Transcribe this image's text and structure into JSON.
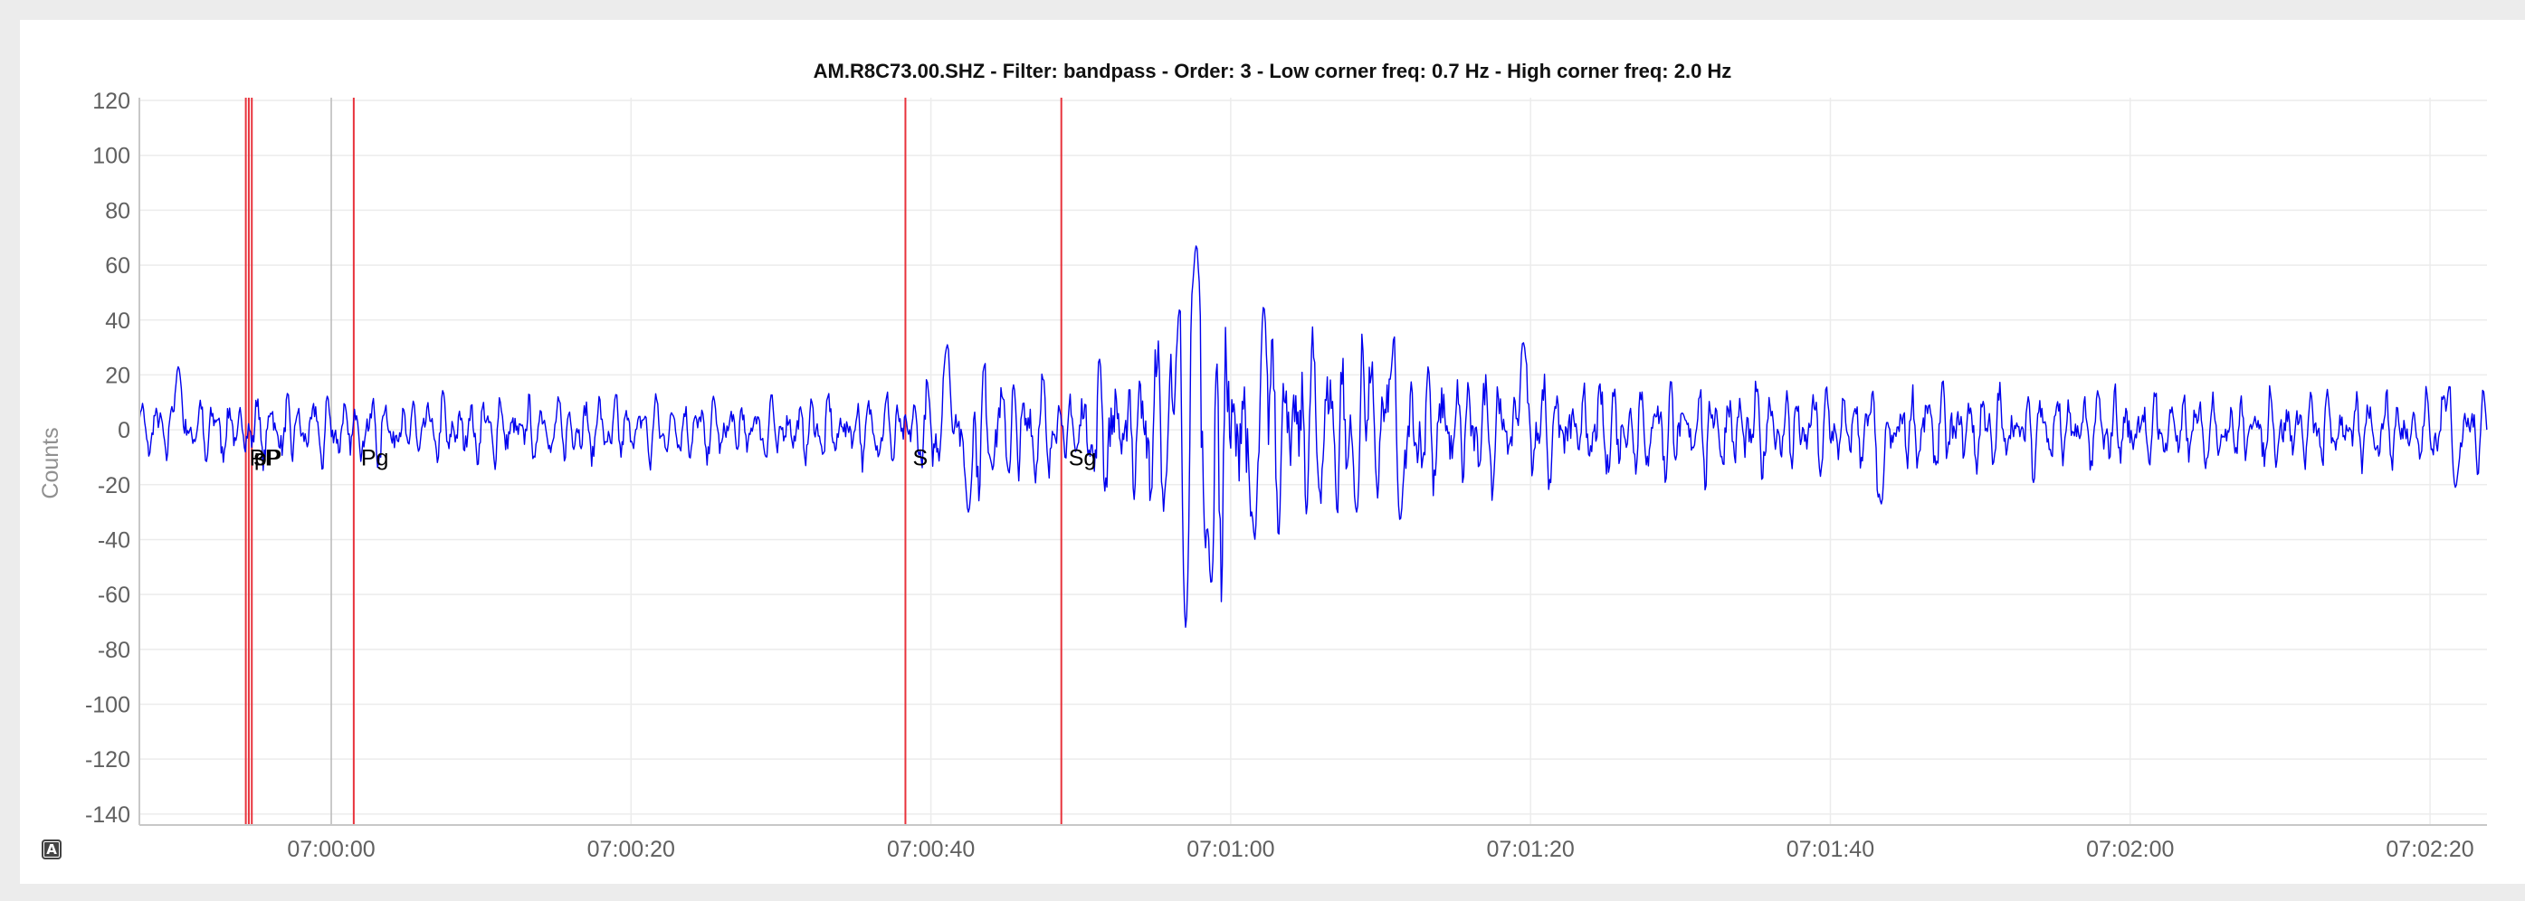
{
  "chart_data": {
    "type": "line",
    "title": "AM.R8C73.00.SHZ - Filter: bandpass - Order: 3 - Low corner freq: 0.7 Hz - High corner freq: 2.0 Hz",
    "ylabel": "Counts",
    "xlabel": "",
    "ylim": [
      -144,
      121
    ],
    "xlim": [
      "06:59:47.2",
      "07:02:23.8"
    ],
    "yticks": [
      120,
      100,
      80,
      60,
      40,
      20,
      0,
      -20,
      -40,
      -60,
      -80,
      -100,
      -120,
      -140
    ],
    "xticks": [
      "07:00:00",
      "07:00:20",
      "07:00:40",
      "07:01:00",
      "07:01:20",
      "07:01:40",
      "07:02:00",
      "07:02:20"
    ],
    "grid": true,
    "series_color": "#0000ee",
    "pick_color": "#e8333c",
    "grey_marker_color": "#bbbbbb",
    "grey_marker_time": "07:00:00",
    "picks": [
      {
        "label": "P",
        "time": "06:59:54.3"
      },
      {
        "label": "pP",
        "time": "06:59:54.5"
      },
      {
        "label": "sP",
        "time": "06:59:54.7"
      },
      {
        "label": "Pg",
        "time": "07:00:01.5"
      },
      {
        "label": "S",
        "time": "07:00:38.3"
      },
      {
        "label": "Sg",
        "time": "07:00:48.7"
      }
    ],
    "envelope": [
      {
        "t": "06:59:47.2",
        "amp": 12
      },
      {
        "t": "06:59:58",
        "amp": 15
      },
      {
        "t": "07:00:30",
        "amp": 13
      },
      {
        "t": "07:00:38",
        "amp": 15
      },
      {
        "t": "07:00:43",
        "amp": 24
      },
      {
        "t": "07:00:50",
        "amp": 22
      },
      {
        "t": "07:00:55",
        "amp": 38
      },
      {
        "t": "07:00:58",
        "amp": 60
      },
      {
        "t": "07:01:01",
        "amp": 52
      },
      {
        "t": "07:01:04",
        "amp": 40
      },
      {
        "t": "07:01:10",
        "amp": 28
      },
      {
        "t": "07:01:20",
        "amp": 22
      },
      {
        "t": "07:01:40",
        "amp": 18
      },
      {
        "t": "07:02:23.8",
        "amp": 15
      }
    ],
    "peaks": [
      {
        "t": "06:59:49.8",
        "y": 23
      },
      {
        "t": "07:00:41.1",
        "y": 31
      },
      {
        "t": "07:00:42.5",
        "y": -30
      },
      {
        "t": "07:00:56.6",
        "y": 44
      },
      {
        "t": "07:00:57.4",
        "y": 43
      },
      {
        "t": "07:00:57.7",
        "y": 67
      },
      {
        "t": "07:00:57.0",
        "y": -72
      },
      {
        "t": "07:00:58.7",
        "y": -56
      },
      {
        "t": "07:01:02.2",
        "y": 45
      },
      {
        "t": "07:01:01.6",
        "y": -40
      },
      {
        "t": "07:01:08.7",
        "y": 36
      },
      {
        "t": "07:01:08.4",
        "y": -30
      },
      {
        "t": "07:01:10.9",
        "y": 34
      },
      {
        "t": "07:01:11.3",
        "y": -33
      },
      {
        "t": "07:01:19.5",
        "y": 32
      },
      {
        "t": "07:01:43.4",
        "y": -27
      },
      {
        "t": "07:02:21.3",
        "y": 16
      },
      {
        "t": "07:02:21.7",
        "y": -21
      }
    ]
  }
}
